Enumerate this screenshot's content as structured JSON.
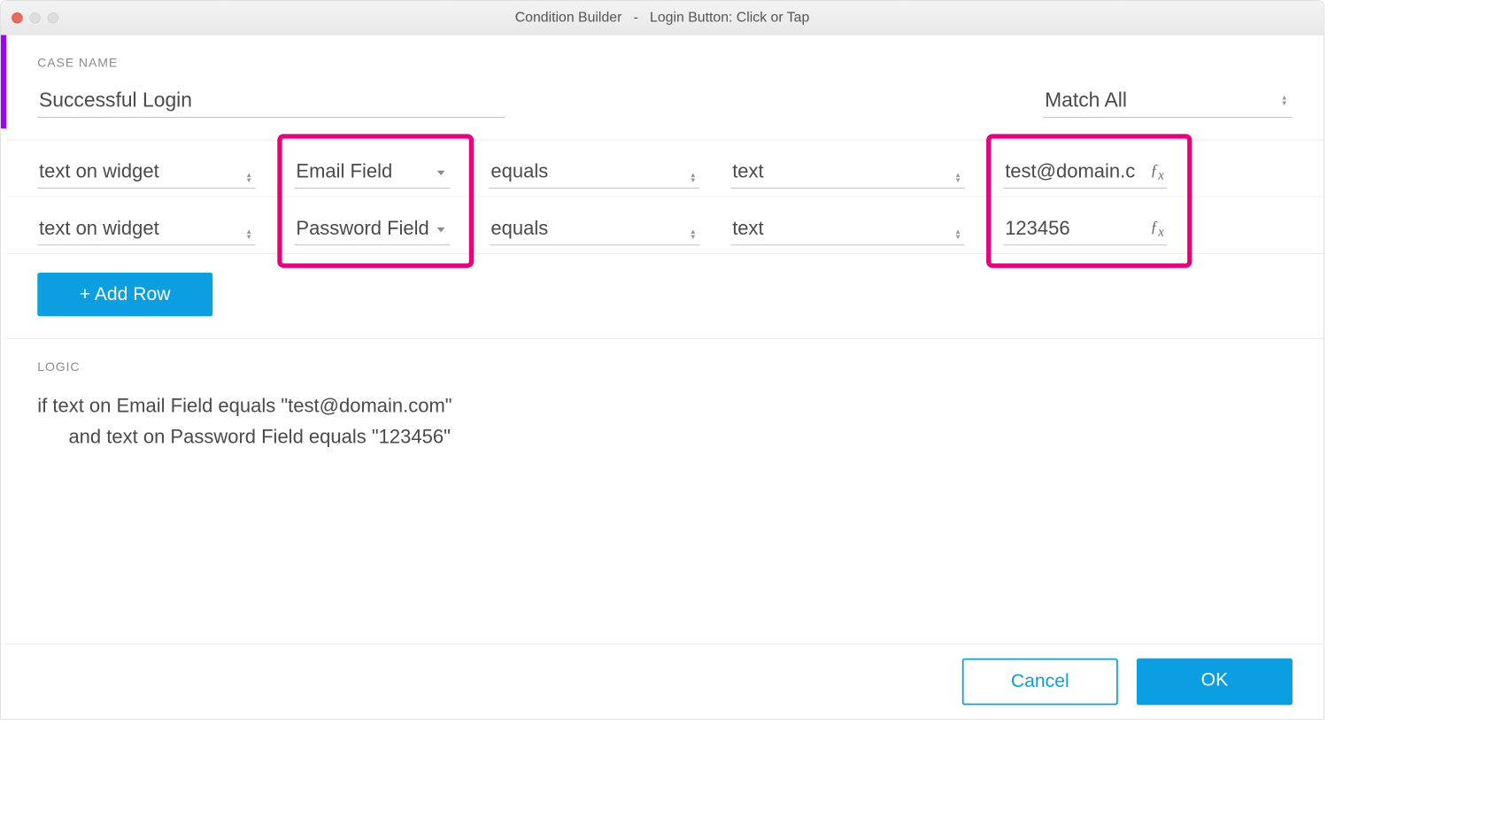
{
  "titlebar": {
    "app_title": "Condition Builder",
    "separator": "-",
    "context": "Login Button: Click or Tap"
  },
  "caseSection": {
    "label": "CASE NAME",
    "value": "Successful Login",
    "matchMode": "Match All"
  },
  "conditions": [
    {
      "attribute": "text on widget",
      "widget": "Email Field",
      "operator": "equals",
      "valueType": "text",
      "value": "test@domain.c"
    },
    {
      "attribute": "text on widget",
      "widget": "Password Field",
      "operator": "equals",
      "valueType": "text",
      "value": "123456"
    }
  ],
  "addRow": {
    "label": "+ Add Row"
  },
  "logic": {
    "label": "LOGIC",
    "line1": "if text on Email Field equals \"test@domain.com\"",
    "line2": "and text on Password Field equals \"123456\""
  },
  "footer": {
    "cancel": "Cancel",
    "ok": "OK"
  }
}
